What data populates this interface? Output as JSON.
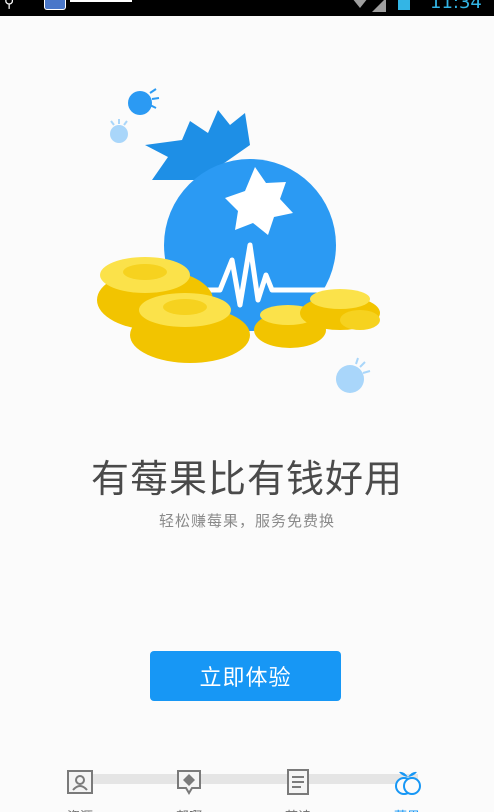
{
  "status_bar": {
    "time": "11:34"
  },
  "illustration": {
    "name": "blueberry-with-gold-ingots"
  },
  "content": {
    "headline": "有莓果比有钱好用",
    "subtitle": "轻松赚莓果，服务免费换",
    "cta_label": "立即体验"
  },
  "tabs": [
    {
      "label": "资源",
      "icon": "contact-card-icon",
      "active": false
    },
    {
      "label": "帮啊",
      "icon": "diamond-chat-icon",
      "active": false
    },
    {
      "label": "荟读",
      "icon": "document-icon",
      "active": false
    },
    {
      "label": "莓果",
      "icon": "berries-icon",
      "active": true
    }
  ],
  "colors": {
    "accent": "#1797f5",
    "gold": "#f6d21f",
    "berry": "#2b9af3"
  }
}
